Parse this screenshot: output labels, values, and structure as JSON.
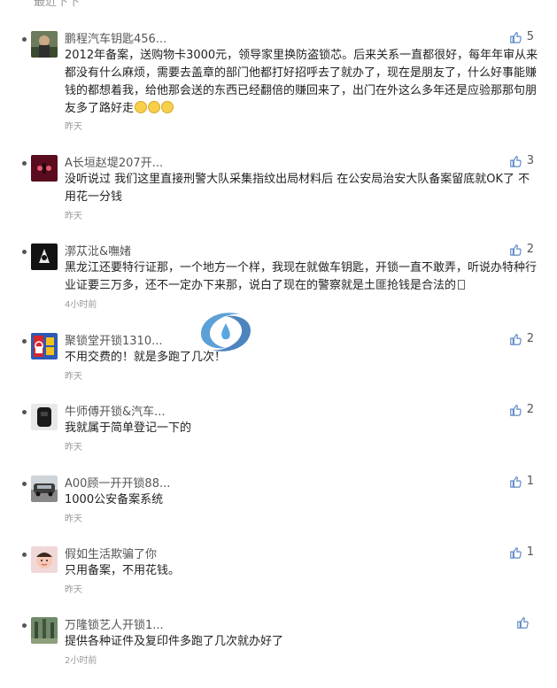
{
  "top_cut_text": "最近下下",
  "comments": [
    {
      "id": "c1",
      "avatar": "avatar-pengcheng",
      "name": "鹏程汽车钥匙456...",
      "likes": "5",
      "text_html_parts": [
        "2012年备案，送购物卡3000元，领导家里换防盗锁芯。后来关系一直都很好，每年年审从来都没有什么麻烦，需要去盖章的部门他都打好招呼去了就办了，现在是朋友了，什么好事能赚钱的都想着我，给他那会送的东西已经翻倍的赚回来了，出门在外这么多年还是应验那那句朋友多了路好走"
      ],
      "emojis": 3,
      "time": "昨天"
    },
    {
      "id": "c2",
      "avatar": "avatar-a",
      "name": "A长垣赵堤207开...",
      "likes": "3",
      "text_html_parts": [
        "没听说过 我们这里直接刑警大队采集指纹出局材料后 在公安局治安大队备案留底就OK了 不用花一分钱"
      ],
      "time": "昨天"
    },
    {
      "id": "c3",
      "avatar": "avatar-dark",
      "name": "漷苁沘&嘸媎",
      "likes": "2",
      "text_html_parts": [
        "黑龙江还要特行证那，一个地方一个样，我现在就做车钥匙，开锁一直不敢弄，听说办特种行业证要三万多，还不一定办下来那，说白了现在的警察就是土匪抢钱是合法的"
      ],
      "trailing_box": true,
      "time": "4小时前"
    },
    {
      "id": "c4",
      "avatar": "avatar-jusuotang",
      "name": "聚锁堂开锁1310...",
      "likes": "2",
      "text_html_parts": [
        "不用交费的！就是多跑了几次！"
      ],
      "time": "昨天"
    },
    {
      "id": "c5",
      "avatar": "avatar-key",
      "name": "牛师傅开锁&汽车...",
      "likes": "2",
      "text_html_parts": [
        "我就属于简单登记一下的"
      ],
      "time": "昨天"
    },
    {
      "id": "c6",
      "avatar": "avatar-car",
      "name": "A00顾一开开锁88...",
      "likes": "1",
      "text_html_parts": [
        "1000公安备案系统"
      ],
      "time": "昨天"
    },
    {
      "id": "c7",
      "avatar": "avatar-baby",
      "name": "假如生活欺骗了你",
      "likes": "1",
      "text_html_parts": [
        "只用备案，不用花钱。"
      ],
      "time": "昨天"
    },
    {
      "id": "c8",
      "avatar": "avatar-forest",
      "name": "万隆锁艺人开锁1...",
      "likes": "",
      "text_html_parts": [
        "提供各种证件及复印件多跑了几次就办好了"
      ],
      "time": "2小时前"
    }
  ],
  "colors": {
    "like_icon": "#5a88c7",
    "name_text": "#555555",
    "time_text": "#999999",
    "body_text": "#222222"
  },
  "icons": {
    "like": "thumbs-up-icon",
    "watermark": "logo-watermark"
  }
}
